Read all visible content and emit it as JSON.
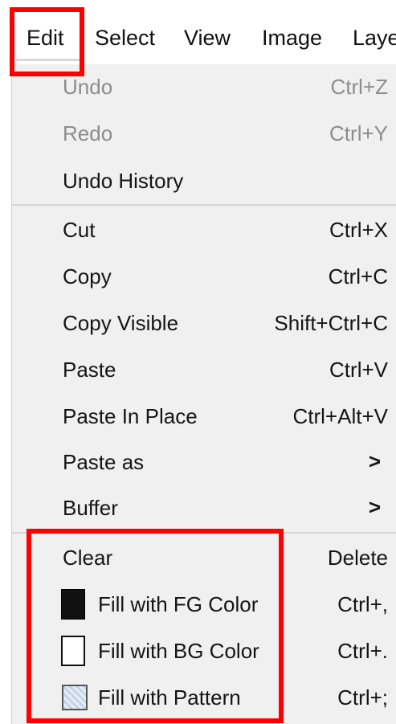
{
  "menubar": {
    "items": [
      {
        "label": "Edit"
      },
      {
        "label": "Select"
      },
      {
        "label": "View"
      },
      {
        "label": "Image"
      },
      {
        "label": "Laye"
      }
    ]
  },
  "edit_menu": {
    "undo": {
      "label": "Undo",
      "shortcut": "Ctrl+Z",
      "disabled": true
    },
    "redo": {
      "label": "Redo",
      "shortcut": "Ctrl+Y",
      "disabled": true
    },
    "undo_history": {
      "label": "Undo History"
    },
    "cut": {
      "label": "Cut",
      "shortcut": "Ctrl+X"
    },
    "copy": {
      "label": "Copy",
      "shortcut": "Ctrl+C"
    },
    "copy_visible": {
      "label": "Copy Visible",
      "shortcut": "Shift+Ctrl+C"
    },
    "paste": {
      "label": "Paste",
      "shortcut": "Ctrl+V"
    },
    "paste_in_place": {
      "label": "Paste In Place",
      "shortcut": "Ctrl+Alt+V"
    },
    "paste_as": {
      "label": "Paste as",
      "arrow": ">"
    },
    "buffer": {
      "label": "Buffer",
      "arrow": ">"
    },
    "clear": {
      "label": "Clear",
      "shortcut": "Delete"
    },
    "fill_fg": {
      "label": "Fill with FG Color",
      "shortcut": "Ctrl+,",
      "icon": "fg-color-swatch-icon"
    },
    "fill_bg": {
      "label": "Fill with BG Color",
      "shortcut": "Ctrl+.",
      "icon": "bg-color-swatch-icon"
    },
    "fill_pattern": {
      "label": "Fill with Pattern",
      "shortcut": "Ctrl+;",
      "icon": "pattern-icon"
    }
  },
  "colors": {
    "annotation_red": "#ff0000",
    "menu_background": "#f0f0f0",
    "disabled_text": "#8c8c8c"
  }
}
